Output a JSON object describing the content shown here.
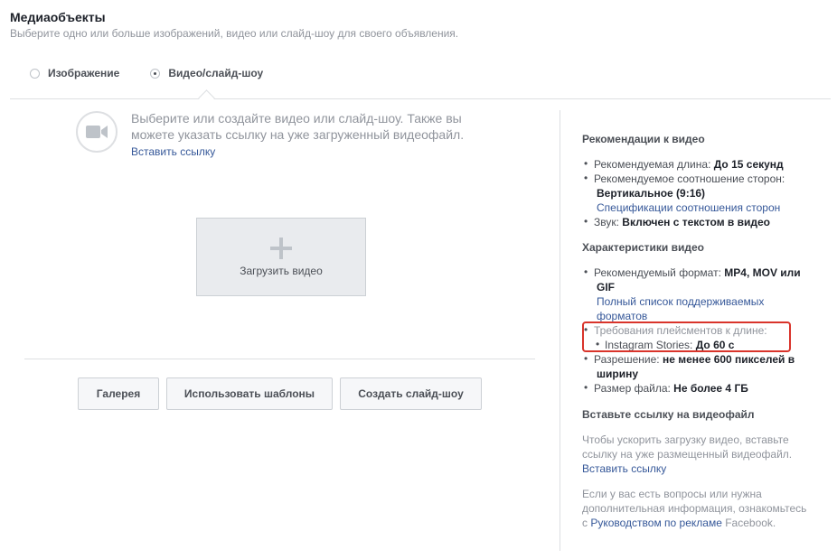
{
  "header": {
    "title": "Медиаобъекты",
    "subtitle": "Выберите одно или больше изображений, видео или слайд-шоу для своего объявления."
  },
  "media_type": {
    "options": [
      {
        "label": "Изображение",
        "selected": false
      },
      {
        "label": "Видео/слайд-шоу",
        "selected": true
      }
    ]
  },
  "main": {
    "icon": "video-camera-icon",
    "intro_line1": "Выберите или создайте видео или слайд-шоу. Также вы",
    "intro_line2": "можете указать ссылку на уже загруженный видеофайл.",
    "insert_link": "Вставить ссылку",
    "upload_label": "Загрузить видео",
    "buttons": {
      "gallery": "Галерея",
      "templates": "Использовать шаблоны",
      "slideshow": "Создать слайд-шоу"
    }
  },
  "right_panel": {
    "rec_heading": "Рекомендации к видео",
    "rec_length_label": "Рекомендуемая длина: ",
    "rec_length_value": "До 15 секунд",
    "rec_ratio_label": "Рекомендуемое соотношение сторон:",
    "rec_ratio_value": "Вертикальное (9:16)",
    "rec_ratio_link": "Спецификации соотношения сторон",
    "rec_sound_label": "Звук: ",
    "rec_sound_value": "Включен с текстом в видео",
    "spec_heading": "Характеристики видео",
    "spec_format_label": "Рекомендуемый формат: ",
    "spec_format_value1": "MP4, MOV или",
    "spec_format_value2": "GIF",
    "spec_format_link1": "Полный список поддерживаемых",
    "spec_format_link2": "форматов",
    "spec_placement_label": "Требования плейсментов к длине:",
    "spec_placement_item_label": "Instagram Stories: ",
    "spec_placement_item_value": "До 60 с",
    "spec_resolution_label": "Разрешение: ",
    "spec_resolution_value1": "не менее 600 пикселей в",
    "spec_resolution_value2": "ширину",
    "spec_size_label": "Размер файла: ",
    "spec_size_value": "Не более 4 ГБ",
    "link_heading": "Вставьте ссылку на видеофайл",
    "link_text1": "Чтобы ускорить загрузку видео, вставьте",
    "link_text2": "ссылку на уже размещенный видеофайл.",
    "link_action": "Вставить ссылку",
    "help_text1": "Если у вас есть вопросы или нужна",
    "help_text2": "дополнительная информация, ознакомьтесь",
    "help_prefix": "с ",
    "help_link": "Руководством по рекламе",
    "help_suffix": " Facebook."
  },
  "colors": {
    "link": "#365899",
    "highlight": "#d9342b",
    "border": "#dddfe2"
  }
}
